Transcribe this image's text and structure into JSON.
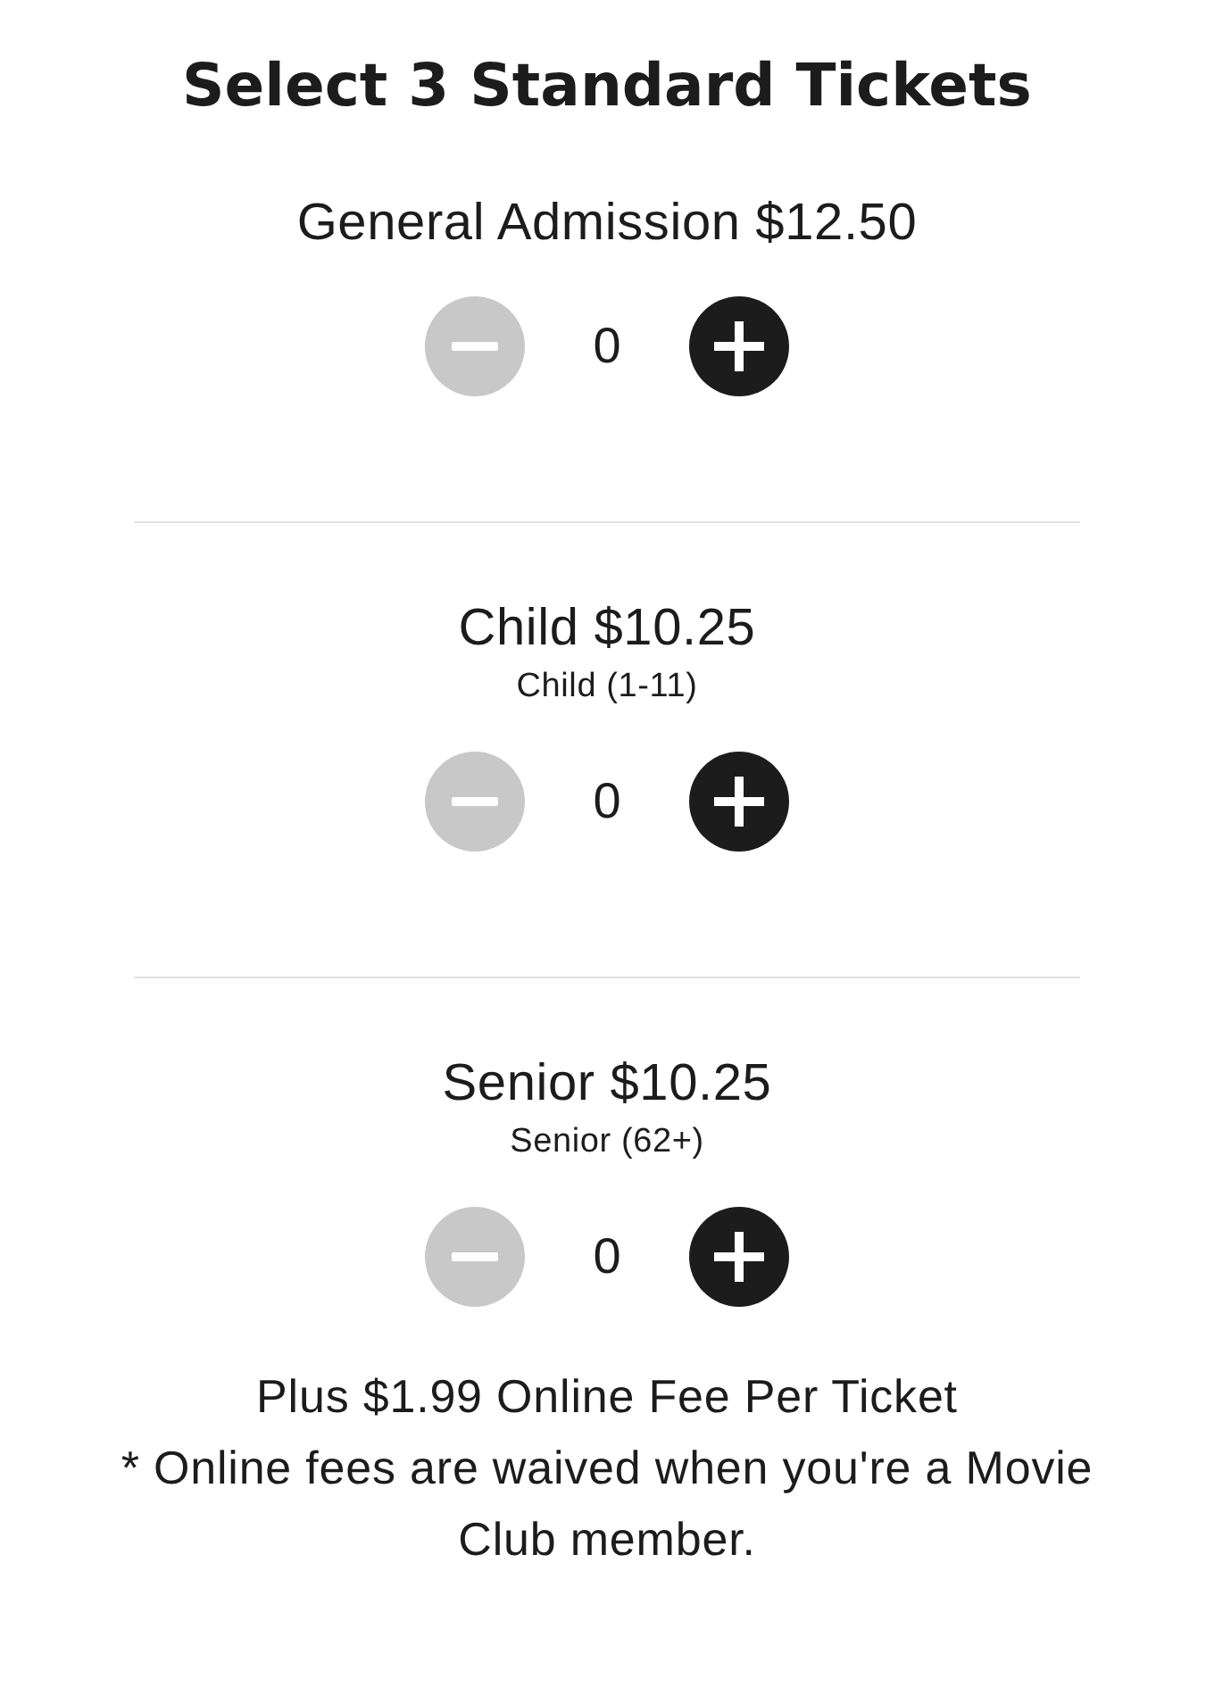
{
  "heading": "Select 3 Standard Tickets",
  "tickets": [
    {
      "title": "General Admission $12.50",
      "count": "0",
      "decrease_disabled": true,
      "increase_disabled": false
    },
    {
      "title": "Child $10.25",
      "subtitle": "Child (1-11)",
      "count": "0",
      "decrease_disabled": true,
      "increase_disabled": false
    },
    {
      "title": "Senior $10.25",
      "subtitle": "Senior (62+)",
      "count": "0",
      "decrease_disabled": true,
      "increase_disabled": false
    }
  ],
  "fee_note": "Plus $1.99 Online Fee Per Ticket",
  "waiver_note": "* Online fees are waived when you're a Movie Club member."
}
